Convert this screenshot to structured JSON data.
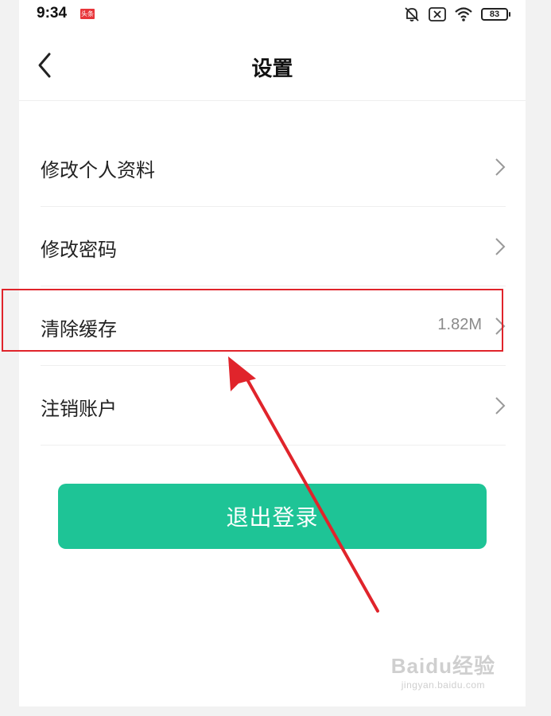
{
  "status_bar": {
    "time": "9:34",
    "news_badge": "头条",
    "battery": "83",
    "icons": [
      "bell-muted-icon",
      "sim-x-icon",
      "wifi-icon",
      "battery-icon"
    ]
  },
  "header": {
    "title": "设置",
    "back_icon": "chevron-left-icon"
  },
  "menu": {
    "items": [
      {
        "label": "修改个人资料",
        "value": ""
      },
      {
        "label": "修改密码",
        "value": ""
      },
      {
        "label": "清除缓存",
        "value": "1.82M"
      },
      {
        "label": "注销账户",
        "value": ""
      }
    ]
  },
  "logout_label": "退出登录",
  "colors": {
    "accent": "#1ec496",
    "annotation": "#e0242b"
  },
  "watermark": {
    "main": "Baidu经验",
    "sub": "jingyan.baidu.com"
  }
}
